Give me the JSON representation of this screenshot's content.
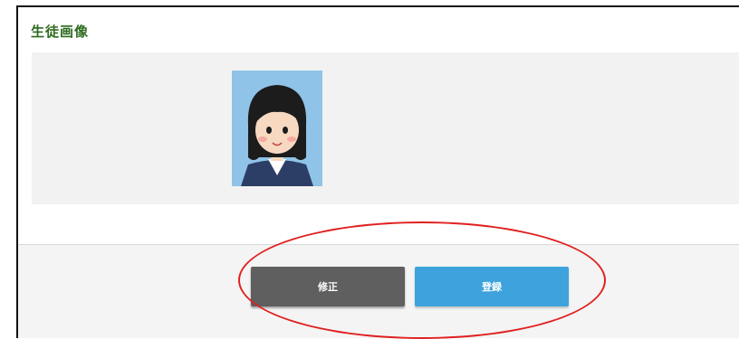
{
  "panel": {
    "title": "生徒画像"
  },
  "photo": {
    "alt": "student-photo",
    "background_color": "#8fc3e8"
  },
  "buttons": {
    "edit_label": "修正",
    "register_label": "登録"
  },
  "colors": {
    "title": "#2e6b1f",
    "edit_button": "#5f5f5f",
    "register_button": "#3ea3dc",
    "annotation": "#e02020"
  }
}
